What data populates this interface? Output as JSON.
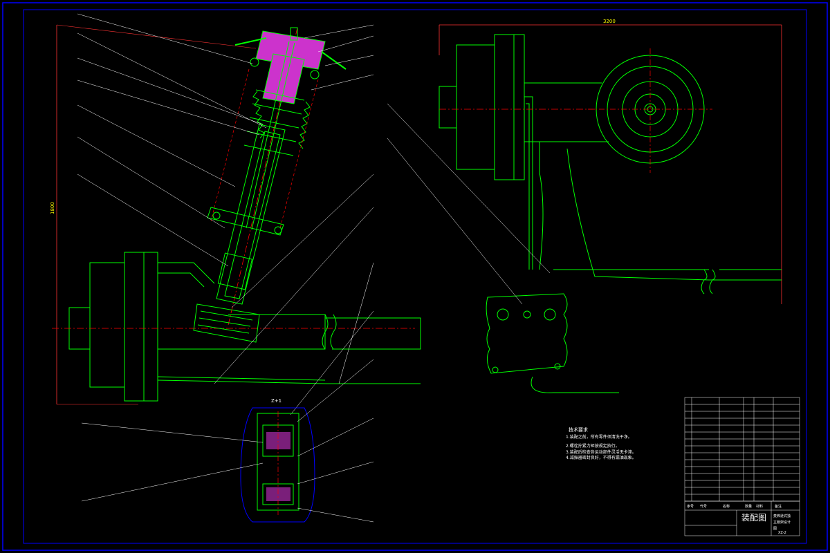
{
  "drawing": {
    "title_cn": "装配图",
    "title_block_right": [
      "麦弗逊式独",
      "立悬架设计",
      "图"
    ],
    "drawing_no": "XZ-2",
    "dim_top": "3200",
    "dim_left": "1800",
    "detail_label": "Z+1",
    "header_cells": [
      "序号",
      "代号",
      "名称",
      "数量",
      "材料",
      "备注"
    ],
    "tech_req_title": "技术要求",
    "tech_req_lines": [
      "1.装配之前，所有零件须清洗干净。",
      "2.螺栓拧紧力矩按规定执行。",
      "3.装配后检查各运动部件灵活无卡滞。",
      "4.减振器密封良好，不得有漏油现象。"
    ],
    "colors": {
      "border": "#0000ff",
      "main": "#00ff00",
      "center": "#ff0000",
      "dim": "#ff0000",
      "spring_fill": "#cc33cc",
      "leader": "#ffffff"
    }
  }
}
